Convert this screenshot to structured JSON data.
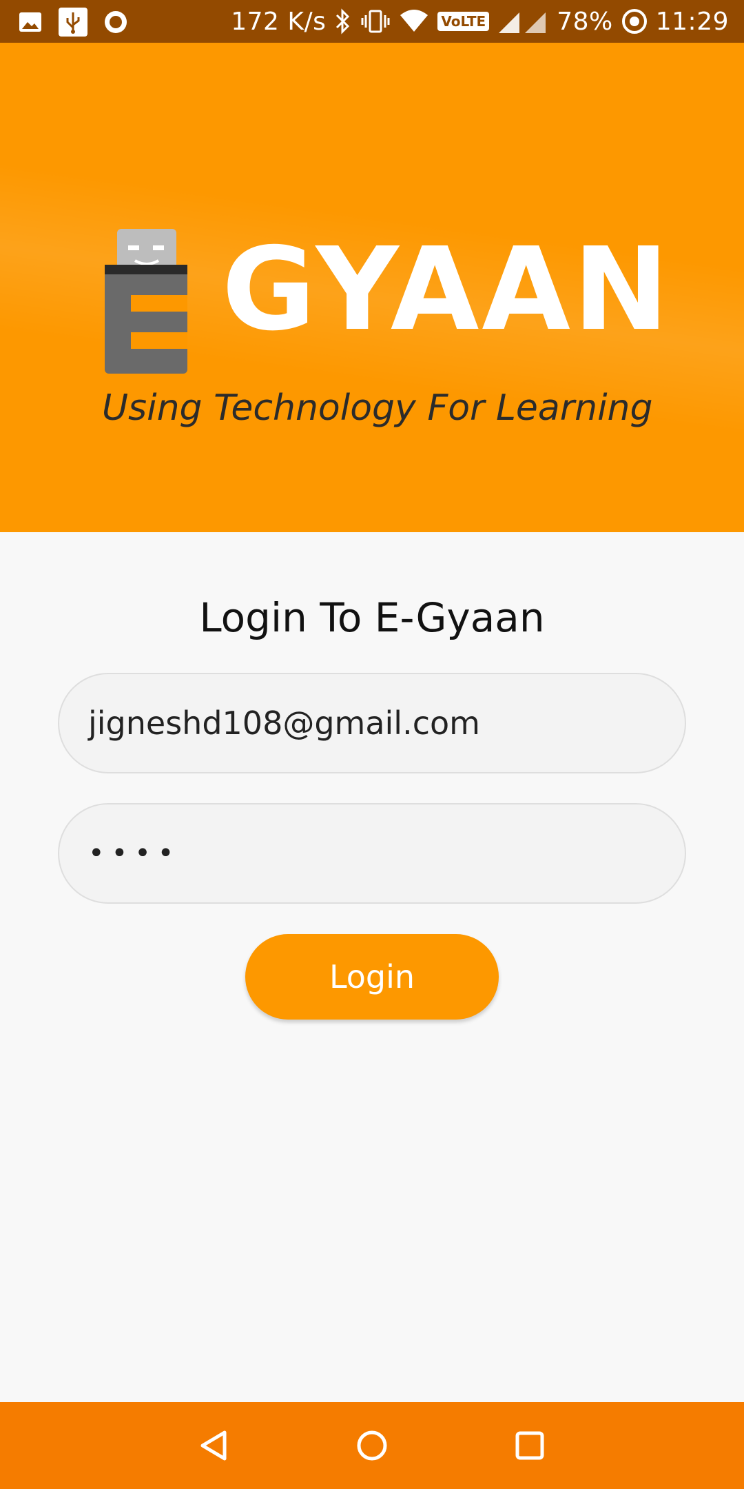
{
  "status_bar": {
    "network_speed": "172 K/s",
    "volte": "VoLTE",
    "battery": "78%",
    "time": "11:29",
    "icons": [
      "gallery-icon",
      "usb-icon",
      "circle-notification-icon",
      "bluetooth-icon",
      "vibrate-icon",
      "wifi-icon",
      "signal-icon",
      "battery-saver-icon"
    ]
  },
  "banner": {
    "logo_wordmark": "GYAAN",
    "tagline": "Using Technology For Learning"
  },
  "login": {
    "title": "Login To E-Gyaan",
    "email_value": "jigneshd108@gmail.com",
    "password_value": "••••",
    "button_label": "Login"
  },
  "nav_bar": {
    "icons": [
      "back-icon",
      "home-icon",
      "recents-icon"
    ]
  },
  "colors": {
    "brand_orange": "#fd9800",
    "status_bar": "#934a00",
    "nav_bar": "#f57c00"
  }
}
